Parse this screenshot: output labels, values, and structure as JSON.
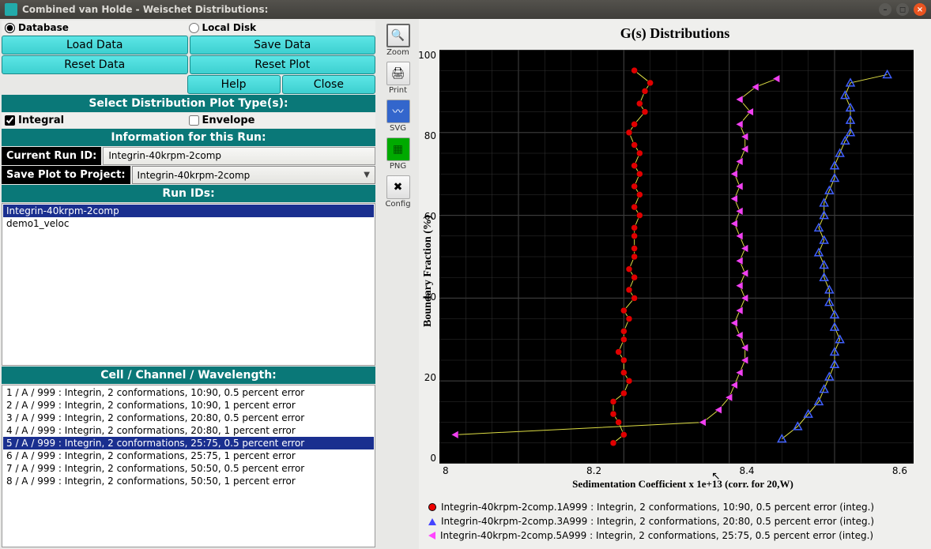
{
  "window": {
    "title": "Combined van Holde - Weischet Distributions:"
  },
  "source": {
    "database": "Database",
    "local_disk": "Local Disk"
  },
  "buttons": {
    "load": "Load Data",
    "save": "Save Data",
    "reset_data": "Reset Data",
    "reset_plot": "Reset Plot",
    "help": "Help",
    "close": "Close"
  },
  "sections": {
    "plot_types": "Select Distribution Plot Type(s):",
    "info": "Information for this Run:",
    "run_ids": "Run IDs:",
    "ccw": "Cell / Channel / Wavelength:"
  },
  "plot_type": {
    "integral": "Integral",
    "envelope": "Envelope"
  },
  "info_labels": {
    "current_run": "Current Run ID:",
    "save_plot": "Save Plot to Project:"
  },
  "current_run_id": "Integrin-40krpm-2comp",
  "save_plot_project": "Integrin-40krpm-2comp",
  "run_ids": [
    "Integrin-40krpm-2comp",
    "demo1_veloc"
  ],
  "run_ids_selected": 0,
  "ccw_items": [
    "1 / A / 999 : Integrin, 2 conformations, 10:90, 0.5 percent error",
    "2 / A / 999 : Integrin, 2 conformations, 10:90, 1 percent error",
    "3 / A / 999 : Integrin, 2 conformations, 20:80, 0.5 percent error",
    "4 / A / 999 : Integrin, 2 conformations, 20:80, 1 percent error",
    "5 / A / 999 : Integrin, 2 conformations, 25:75, 0.5 percent error",
    "6 / A / 999 : Integrin, 2 conformations, 25:75, 1 percent error",
    "7 / A / 999 : Integrin, 2 conformations, 50:50, 0.5 percent error",
    "8 / A / 999 : Integrin, 2 conformations, 50:50, 1 percent error"
  ],
  "ccw_selected": 4,
  "tools": {
    "zoom": "Zoom",
    "print": "Print",
    "svg": "SVG",
    "png": "PNG",
    "config": "Config"
  },
  "chart_data": {
    "type": "scatter",
    "title": "G(s) Distributions",
    "xlabel": "Sedimentation Coefficient x 1e+13 (corr. for 20,W)",
    "ylabel": "Boundary Fraction (%)",
    "xlim": [
      7.85,
      8.75
    ],
    "ylim": [
      0,
      100
    ],
    "xticks": [
      8.0,
      8.2,
      8.4,
      8.6
    ],
    "yticks": [
      0,
      20,
      40,
      60,
      80,
      100
    ],
    "series": [
      {
        "name": "Integrin-40krpm-2comp.1A999 : Integrin, 2 conformations, 10:90, 0.5 percent error (integ.)",
        "marker": "circle",
        "color": "#e00000",
        "points": [
          [
            8.18,
            5
          ],
          [
            8.2,
            7
          ],
          [
            8.19,
            10
          ],
          [
            8.18,
            12
          ],
          [
            8.18,
            15
          ],
          [
            8.2,
            17
          ],
          [
            8.21,
            20
          ],
          [
            8.2,
            22
          ],
          [
            8.2,
            25
          ],
          [
            8.19,
            27
          ],
          [
            8.2,
            30
          ],
          [
            8.2,
            32
          ],
          [
            8.21,
            35
          ],
          [
            8.2,
            37
          ],
          [
            8.22,
            40
          ],
          [
            8.21,
            42
          ],
          [
            8.22,
            45
          ],
          [
            8.21,
            47
          ],
          [
            8.22,
            50
          ],
          [
            8.22,
            52
          ],
          [
            8.22,
            55
          ],
          [
            8.22,
            57
          ],
          [
            8.23,
            60
          ],
          [
            8.22,
            62
          ],
          [
            8.23,
            65
          ],
          [
            8.22,
            67
          ],
          [
            8.23,
            70
          ],
          [
            8.22,
            72
          ],
          [
            8.23,
            75
          ],
          [
            8.22,
            77
          ],
          [
            8.21,
            80
          ],
          [
            8.22,
            82
          ],
          [
            8.24,
            85
          ],
          [
            8.23,
            87
          ],
          [
            8.24,
            90
          ],
          [
            8.25,
            92
          ],
          [
            8.22,
            95
          ]
        ]
      },
      {
        "name": "Integrin-40krpm-2comp.3A999 : Integrin, 2 conformations, 20:80, 0.5 percent error (integ.)",
        "marker": "tri-up",
        "color": "#4060ff",
        "points": [
          [
            8.5,
            6
          ],
          [
            8.53,
            9
          ],
          [
            8.55,
            12
          ],
          [
            8.57,
            15
          ],
          [
            8.58,
            18
          ],
          [
            8.59,
            21
          ],
          [
            8.6,
            24
          ],
          [
            8.6,
            27
          ],
          [
            8.61,
            30
          ],
          [
            8.6,
            33
          ],
          [
            8.6,
            36
          ],
          [
            8.59,
            39
          ],
          [
            8.59,
            42
          ],
          [
            8.58,
            45
          ],
          [
            8.58,
            48
          ],
          [
            8.57,
            51
          ],
          [
            8.58,
            54
          ],
          [
            8.57,
            57
          ],
          [
            8.58,
            60
          ],
          [
            8.58,
            63
          ],
          [
            8.59,
            66
          ],
          [
            8.6,
            69
          ],
          [
            8.6,
            72
          ],
          [
            8.61,
            75
          ],
          [
            8.62,
            78
          ],
          [
            8.63,
            80
          ],
          [
            8.63,
            83
          ],
          [
            8.63,
            86
          ],
          [
            8.62,
            89
          ],
          [
            8.63,
            92
          ],
          [
            8.7,
            94
          ]
        ]
      },
      {
        "name": "Integrin-40krpm-2comp.5A999 : Integrin, 2 conformations, 25:75, 0.5 percent error (integ.)",
        "marker": "tri-left",
        "color": "#f040f0",
        "points": [
          [
            7.88,
            7
          ],
          [
            8.35,
            10
          ],
          [
            8.38,
            13
          ],
          [
            8.4,
            16
          ],
          [
            8.41,
            19
          ],
          [
            8.42,
            22
          ],
          [
            8.43,
            25
          ],
          [
            8.43,
            28
          ],
          [
            8.42,
            31
          ],
          [
            8.41,
            34
          ],
          [
            8.42,
            37
          ],
          [
            8.43,
            40
          ],
          [
            8.42,
            43
          ],
          [
            8.43,
            46
          ],
          [
            8.42,
            49
          ],
          [
            8.43,
            52
          ],
          [
            8.42,
            55
          ],
          [
            8.41,
            58
          ],
          [
            8.42,
            61
          ],
          [
            8.41,
            64
          ],
          [
            8.42,
            67
          ],
          [
            8.41,
            70
          ],
          [
            8.42,
            73
          ],
          [
            8.43,
            76
          ],
          [
            8.43,
            79
          ],
          [
            8.42,
            82
          ],
          [
            8.44,
            85
          ],
          [
            8.42,
            88
          ],
          [
            8.45,
            91
          ],
          [
            8.49,
            93
          ]
        ]
      }
    ]
  }
}
